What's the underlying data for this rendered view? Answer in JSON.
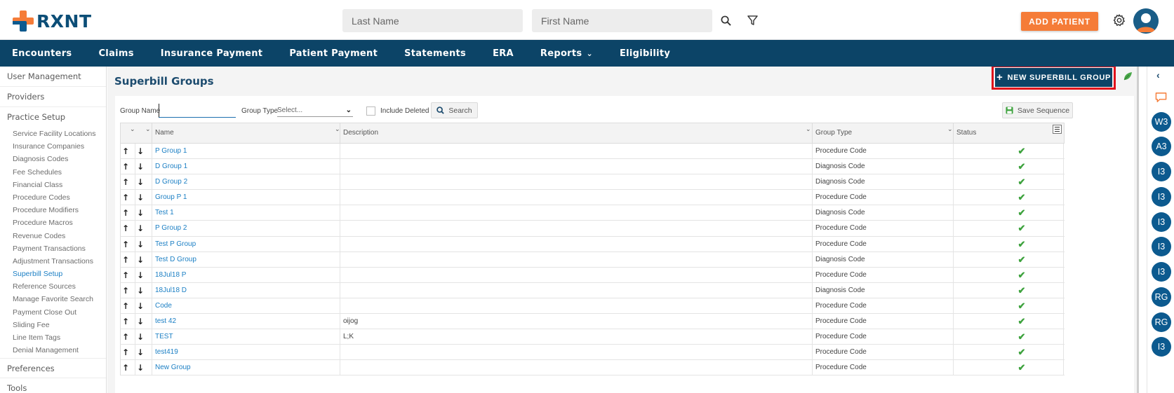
{
  "brand": {
    "name": "RXNT",
    "logo_colors": [
      "#f57c38",
      "#0c5a8f"
    ]
  },
  "header": {
    "last_name_placeholder": "Last Name",
    "first_name_placeholder": "First Name",
    "add_patient_label": "ADD PATIENT",
    "icons": [
      "search-icon",
      "filter-icon",
      "gear-icon",
      "user-avatar"
    ]
  },
  "nav": {
    "items": [
      {
        "label": "Encounters"
      },
      {
        "label": "Claims"
      },
      {
        "label": "Insurance Payment"
      },
      {
        "label": "Patient Payment"
      },
      {
        "label": "Statements"
      },
      {
        "label": "ERA"
      },
      {
        "label": "Reports"
      },
      {
        "label": "Eligibility"
      }
    ]
  },
  "sidebar": {
    "sections": {
      "user_management": "User Management",
      "providers": "Providers",
      "practice_setup": "Practice Setup",
      "preferences": "Preferences",
      "tools": "Tools"
    },
    "practice_items": [
      "Service Facility Locations",
      "Insurance Companies",
      "Diagnosis Codes",
      "Fee Schedules",
      "Financial Class",
      "Procedure Codes",
      "Procedure Modifiers",
      "Procedure Macros",
      "Revenue Codes",
      "Payment Transactions",
      "Adjustment Transactions",
      "Superbill Setup",
      "Reference Sources",
      "Manage Favorite Search",
      "Payment Close Out",
      "Sliding Fee",
      "Line Item Tags",
      "Denial Management"
    ],
    "active_item": "Superbill Setup"
  },
  "page": {
    "title": "Superbill Groups",
    "new_button_label": "NEW SUPERBILL GROUP"
  },
  "filters": {
    "group_name_label": "Group Name",
    "group_name_value": "",
    "group_type_label": "Group Type",
    "group_type_selected": "Select...",
    "include_deleted_label": "Include Deleted",
    "search_label": "Search",
    "save_sequence_label": "Save Sequence"
  },
  "grid": {
    "columns": [
      "Name",
      "Description",
      "Group Type",
      "Status"
    ],
    "rows": [
      {
        "name": "P Group 1",
        "description": "",
        "group_type": "Procedure Code",
        "status": "active"
      },
      {
        "name": "D Group 1",
        "description": "",
        "group_type": "Diagnosis Code",
        "status": "active"
      },
      {
        "name": "D Group 2",
        "description": "",
        "group_type": "Diagnosis Code",
        "status": "active"
      },
      {
        "name": "Group P 1",
        "description": "",
        "group_type": "Procedure Code",
        "status": "active"
      },
      {
        "name": "Test 1",
        "description": "",
        "group_type": "Diagnosis Code",
        "status": "active"
      },
      {
        "name": "P Group 2",
        "description": "",
        "group_type": "Procedure Code",
        "status": "active"
      },
      {
        "name": "Test P Group",
        "description": "",
        "group_type": "Procedure Code",
        "status": "active"
      },
      {
        "name": "Test D Group",
        "description": "",
        "group_type": "Diagnosis Code",
        "status": "active"
      },
      {
        "name": "18Jul18 P",
        "description": "",
        "group_type": "Procedure Code",
        "status": "active"
      },
      {
        "name": "18Jul18 D",
        "description": "",
        "group_type": "Diagnosis Code",
        "status": "active"
      },
      {
        "name": "Code",
        "description": "",
        "group_type": "Procedure Code",
        "status": "active"
      },
      {
        "name": "test 42",
        "description": "oijog",
        "group_type": "Procedure Code",
        "status": "active"
      },
      {
        "name": "TEST",
        "description": "L;K",
        "group_type": "Procedure Code",
        "status": "active"
      },
      {
        "name": "test419",
        "description": "",
        "group_type": "Procedure Code",
        "status": "active"
      },
      {
        "name": "New Group",
        "description": "",
        "group_type": "Procedure Code",
        "status": "active"
      }
    ]
  },
  "right_rail": {
    "badges": [
      "W3",
      "A3",
      "I3",
      "I3",
      "I3",
      "I3",
      "I3",
      "RG",
      "RG",
      "I3"
    ]
  },
  "colors": {
    "nav_bg": "#0c4467",
    "accent_orange": "#f57c38",
    "link_blue": "#1b7fc4",
    "highlight_red": "#e0111b",
    "status_green": "#3da23d"
  }
}
